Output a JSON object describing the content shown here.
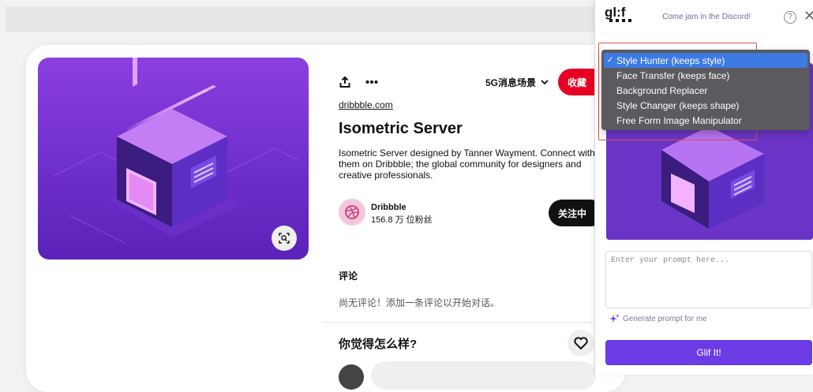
{
  "pin": {
    "source": "dribbble.com",
    "title": "Isometric Server",
    "description": "Isometric Server designed by Tanner Wayment. Connect with them on Dribbble; the global community for designers and creative professionals.",
    "board": "5G消息场景",
    "save_label": "收藏",
    "creator": {
      "name": "Dribbble",
      "followers": "156.8 万 位粉丝"
    },
    "follow_label": "关注中",
    "comments_heading": "评论",
    "no_comments": "尚无评论！添加一条评论以开始对话。",
    "question": "你觉得怎么样?"
  },
  "extension": {
    "discord_text": "Come jam in the Discord!",
    "help_icon": "question-circle-icon",
    "close_icon": "close-icon",
    "help_glyph": "?",
    "close_glyph": "✕",
    "modes": [
      {
        "label": "Style Hunter (keeps style)",
        "selected": true
      },
      {
        "label": "Face Transfer (keeps face)",
        "selected": false
      },
      {
        "label": "Background Replacer",
        "selected": false
      },
      {
        "label": "Style Changer (keeps shape)",
        "selected": false
      },
      {
        "label": "Free Form Image Manipulator",
        "selected": false
      }
    ],
    "prompt_placeholder": "Enter your prompt here...",
    "generate_prompt_label": "Generate prompt for me",
    "submit_label": "Glif It!"
  },
  "colors": {
    "save_red": "#e60023",
    "accent_purple": "#6c3be6",
    "selected_blue": "#3d7be3",
    "image_purple": "#6a35c6"
  }
}
